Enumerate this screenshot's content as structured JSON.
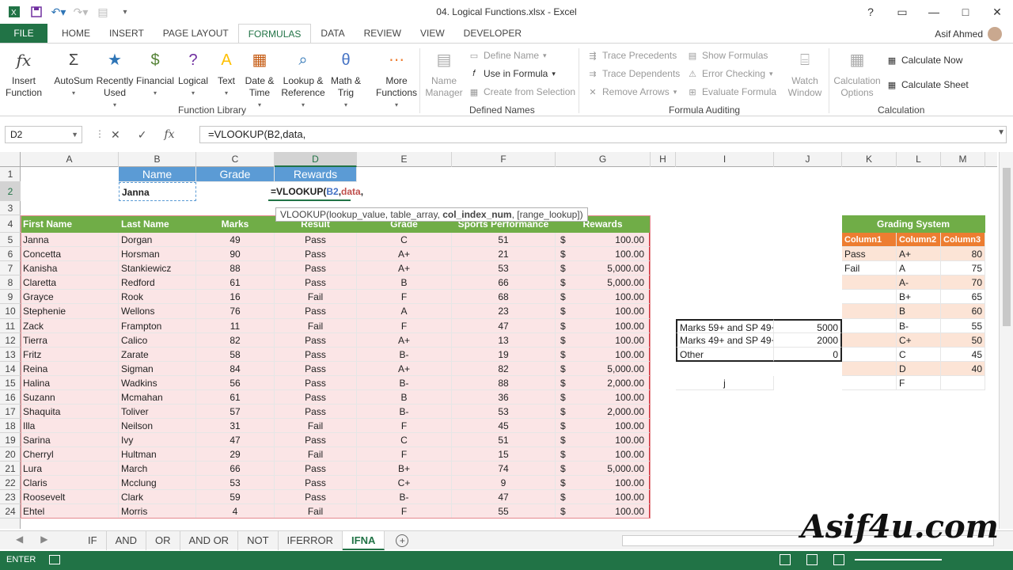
{
  "window": {
    "title": "04. Logical Functions.xlsx - Excel",
    "user": "Asif Ahmed",
    "controls": [
      "?",
      "▭",
      "—",
      "□",
      "✕"
    ]
  },
  "ribbon_tabs": [
    "HOME",
    "INSERT",
    "PAGE LAYOUT",
    "FORMULAS",
    "DATA",
    "REVIEW",
    "VIEW",
    "DEVELOPER"
  ],
  "file_tab": "FILE",
  "ribbon": {
    "insert_function": "Insert\nFunction",
    "library": [
      {
        "label": "AutoSum",
        "icon": "Σ",
        "color": "#444"
      },
      {
        "label": "Recently\nUsed",
        "icon": "★",
        "color": "#2e75b6"
      },
      {
        "label": "Financial",
        "icon": "$",
        "color": "#548235"
      },
      {
        "label": "Logical",
        "icon": "?",
        "color": "#7030a0"
      },
      {
        "label": "Text",
        "icon": "A",
        "color": "#ffc000"
      },
      {
        "label": "Date &\nTime",
        "icon": "▦",
        "color": "#c55a11"
      },
      {
        "label": "Lookup &\nReference",
        "icon": "⌕",
        "color": "#2e75b6"
      },
      {
        "label": "Math &\nTrig",
        "icon": "θ",
        "color": "#4472c4"
      },
      {
        "label": "More\nFunctions",
        "icon": "⋯",
        "color": "#ed7d31"
      }
    ],
    "group_function_library": "Function Library",
    "name_manager": "Name\nManager",
    "define_name": "Define Name",
    "use_in_formula": "Use in Formula",
    "create_from_selection": "Create from Selection",
    "group_defined_names": "Defined Names",
    "trace_precedents": "Trace Precedents",
    "trace_dependents": "Trace Dependents",
    "remove_arrows": "Remove Arrows",
    "show_formulas": "Show Formulas",
    "error_checking": "Error Checking",
    "evaluate_formula": "Evaluate Formula",
    "watch_window": "Watch\nWindow",
    "group_formula_auditing": "Formula Auditing",
    "calculation_options": "Calculation\nOptions",
    "calculate_now": "Calculate Now",
    "calculate_sheet": "Calculate Sheet",
    "group_calculation": "Calculation"
  },
  "formula_bar": {
    "name_box": "D2",
    "formula": "=VLOOKUP(B2,data,"
  },
  "columns": [
    "A",
    "B",
    "C",
    "D",
    "E",
    "F",
    "G",
    "H",
    "I",
    "J",
    "K",
    "L",
    "M"
  ],
  "rows": [
    "1",
    "2",
    "3",
    "4",
    "5",
    "6",
    "7",
    "8",
    "9",
    "10",
    "11",
    "12",
    "13",
    "14",
    "15",
    "16",
    "17",
    "18",
    "19",
    "20",
    "21",
    "22",
    "23",
    "24"
  ],
  "lookup_header": {
    "name": "Name",
    "grade": "Grade",
    "rewards": "Rewards"
  },
  "lookup_row": {
    "name": "Janna",
    "formula_pre": "=VLOOKUP(",
    "formula_ref": "B2",
    "formula_sep": ",",
    "formula_name": "data",
    "formula_post": ","
  },
  "tooltip": {
    "pre": "VLOOKUP(lookup_value, table_array, ",
    "bold": "col_index_num",
    "post": ", [range_lookup])"
  },
  "table_headers": [
    "First Name",
    "Last Name",
    "Marks",
    "Result",
    "Grade",
    "Sports Performance",
    "Rewards"
  ],
  "table_rows": [
    [
      "Janna",
      "Dorgan",
      "49",
      "Pass",
      "C",
      "51",
      "$",
      "100.00"
    ],
    [
      "Concetta",
      "Horsman",
      "90",
      "Pass",
      "A+",
      "21",
      "$",
      "100.00"
    ],
    [
      "Kanisha",
      "Stankiewicz",
      "88",
      "Pass",
      "A+",
      "53",
      "$",
      "5,000.00"
    ],
    [
      "Claretta",
      "Redford",
      "61",
      "Pass",
      "B",
      "66",
      "$",
      "5,000.00"
    ],
    [
      "Grayce",
      "Rook",
      "16",
      "Fail",
      "F",
      "68",
      "$",
      "100.00"
    ],
    [
      "Stephenie",
      "Wellons",
      "76",
      "Pass",
      "A",
      "23",
      "$",
      "100.00"
    ],
    [
      "Zack",
      "Frampton",
      "11",
      "Fail",
      "F",
      "47",
      "$",
      "100.00"
    ],
    [
      "Tierra",
      "Calico",
      "82",
      "Pass",
      "A+",
      "13",
      "$",
      "100.00"
    ],
    [
      "Fritz",
      "Zarate",
      "58",
      "Pass",
      "B-",
      "19",
      "$",
      "100.00"
    ],
    [
      "Reina",
      "Sigman",
      "84",
      "Pass",
      "A+",
      "82",
      "$",
      "5,000.00"
    ],
    [
      "Halina",
      "Wadkins",
      "56",
      "Pass",
      "B-",
      "88",
      "$",
      "2,000.00"
    ],
    [
      "Suzann",
      "Mcmahan",
      "61",
      "Pass",
      "B",
      "36",
      "$",
      "100.00"
    ],
    [
      "Shaquita",
      "Toliver",
      "57",
      "Pass",
      "B-",
      "53",
      "$",
      "2,000.00"
    ],
    [
      "Illa",
      "Neilson",
      "31",
      "Fail",
      "F",
      "45",
      "$",
      "100.00"
    ],
    [
      "Sarina",
      "Ivy",
      "47",
      "Pass",
      "C",
      "51",
      "$",
      "100.00"
    ],
    [
      "Cherryl",
      "Hultman",
      "29",
      "Fail",
      "F",
      "15",
      "$",
      "100.00"
    ],
    [
      "Lura",
      "March",
      "66",
      "Pass",
      "B+",
      "74",
      "$",
      "5,000.00"
    ],
    [
      "Claris",
      "Mcclung",
      "53",
      "Pass",
      "C+",
      "9",
      "$",
      "100.00"
    ],
    [
      "Roosevelt",
      "Clark",
      "59",
      "Pass",
      "B-",
      "47",
      "$",
      "100.00"
    ],
    [
      "Ehtel",
      "Morris",
      "4",
      "Fail",
      "F",
      "55",
      "$",
      "100.00"
    ]
  ],
  "criteria_box": [
    [
      "Marks 59+ and SP 49+",
      "5000"
    ],
    [
      "Marks 49+ and SP 49+",
      "2000"
    ],
    [
      "Other",
      "0"
    ]
  ],
  "stray_i15": "j",
  "grading": {
    "title": "Grading System",
    "headers": [
      "Column1",
      "Column2",
      "Column3"
    ],
    "rows": [
      [
        "Pass",
        "A+",
        "80"
      ],
      [
        "Fail",
        "A",
        "75"
      ],
      [
        "",
        "A-",
        "70"
      ],
      [
        "",
        "B+",
        "65"
      ],
      [
        "",
        "B",
        "60"
      ],
      [
        "",
        "B-",
        "55"
      ],
      [
        "",
        "C+",
        "50"
      ],
      [
        "",
        "C",
        "45"
      ],
      [
        "",
        "D",
        "40"
      ],
      [
        "",
        "F",
        ""
      ]
    ]
  },
  "sheet_tabs": [
    "IF",
    "AND",
    "OR",
    "AND OR",
    "NOT",
    "IFERROR",
    "IFNA"
  ],
  "active_sheet": "IFNA",
  "status": {
    "mode": "ENTER"
  },
  "watermark": "Asif4u.com",
  "colors": {
    "excel_green": "#217346",
    "table_header": "#70ad47",
    "lookup_header": "#5b9bd5",
    "grading_header": "#ed7d31"
  }
}
